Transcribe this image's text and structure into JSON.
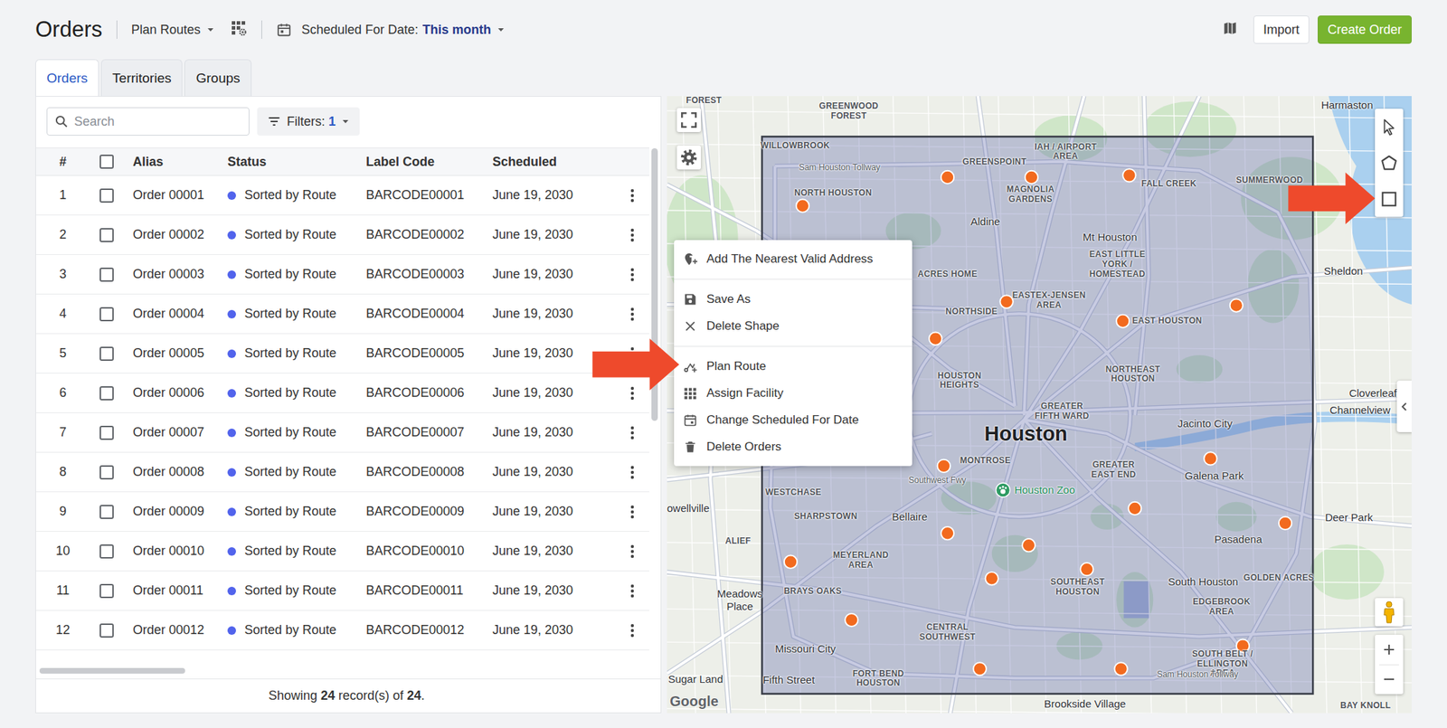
{
  "header": {
    "title": "Orders",
    "plan_routes": "Plan Routes",
    "date_label": "Scheduled For Date:",
    "date_value": "This month",
    "import": "Import",
    "create": "Create Order"
  },
  "tabs": [
    {
      "label": "Orders",
      "selected": true
    },
    {
      "label": "Territories",
      "selected": false
    },
    {
      "label": "Groups",
      "selected": false
    }
  ],
  "search": {
    "placeholder": "Search"
  },
  "filters": {
    "label": "Filters:",
    "count": "1"
  },
  "table": {
    "columns": [
      "#",
      "Alias",
      "Status",
      "Label Code",
      "Scheduled"
    ],
    "all_checked": false,
    "rows": [
      {
        "num": "1",
        "checked": false,
        "alias": "Order 00001",
        "status": "Sorted by Route",
        "label_code": "BARCODE00001",
        "scheduled": "June 19, 2030"
      },
      {
        "num": "2",
        "checked": false,
        "alias": "Order 00002",
        "status": "Sorted by Route",
        "label_code": "BARCODE00002",
        "scheduled": "June 19, 2030"
      },
      {
        "num": "3",
        "checked": false,
        "alias": "Order 00003",
        "status": "Sorted by Route",
        "label_code": "BARCODE00003",
        "scheduled": "June 19, 2030"
      },
      {
        "num": "4",
        "checked": false,
        "alias": "Order 00004",
        "status": "Sorted by Route",
        "label_code": "BARCODE00004",
        "scheduled": "June 19, 2030"
      },
      {
        "num": "5",
        "checked": false,
        "alias": "Order 00005",
        "status": "Sorted by Route",
        "label_code": "BARCODE00005",
        "scheduled": "June 19, 2030"
      },
      {
        "num": "6",
        "checked": false,
        "alias": "Order 00006",
        "status": "Sorted by Route",
        "label_code": "BARCODE00006",
        "scheduled": "June 19, 2030"
      },
      {
        "num": "7",
        "checked": false,
        "alias": "Order 00007",
        "status": "Sorted by Route",
        "label_code": "BARCODE00007",
        "scheduled": "June 19, 2030"
      },
      {
        "num": "8",
        "checked": false,
        "alias": "Order 00008",
        "status": "Sorted by Route",
        "label_code": "BARCODE00008",
        "scheduled": "June 19, 2030"
      },
      {
        "num": "9",
        "checked": false,
        "alias": "Order 00009",
        "status": "Sorted by Route",
        "label_code": "BARCODE00009",
        "scheduled": "June 19, 2030"
      },
      {
        "num": "10",
        "checked": false,
        "alias": "Order 00010",
        "status": "Sorted by Route",
        "label_code": "BARCODE00010",
        "scheduled": "June 19, 2030"
      },
      {
        "num": "11",
        "checked": false,
        "alias": "Order 00011",
        "status": "Sorted by Route",
        "label_code": "BARCODE00011",
        "scheduled": "June 19, 2030"
      },
      {
        "num": "12",
        "checked": false,
        "alias": "Order 00012",
        "status": "Sorted by Route",
        "label_code": "BARCODE00012",
        "scheduled": "June 19, 2030"
      }
    ]
  },
  "footer": {
    "showing": "Showing",
    "shown": "24",
    "records_of": "record(s) of",
    "total": "24",
    "end": "."
  },
  "map": {
    "attribution": "Google",
    "labels": [
      {
        "text": "FOREST",
        "kind": "district"
      },
      {
        "text": "GREENWOOD\nFOREST",
        "kind": "district"
      },
      {
        "text": "WILLOWBROOK",
        "kind": "district"
      },
      {
        "text": "GREENSPOINT",
        "kind": "district"
      },
      {
        "text": "IAH / AIRPORT\nAREA",
        "kind": "district"
      },
      {
        "text": "FALL CREEK",
        "kind": "district"
      },
      {
        "text": "SUMMERWOOD",
        "kind": "district"
      },
      {
        "text": "NORTH HOUSTON",
        "kind": "district"
      },
      {
        "text": "MAGNOLIA\nGARDENS",
        "kind": "district"
      },
      {
        "text": "EAST LITTLE\nYORK /\nHOMESTEAD",
        "kind": "district"
      },
      {
        "text": "ACRES HOME",
        "kind": "district"
      },
      {
        "text": "EASTEX-JENSEN\nAREA",
        "kind": "district"
      },
      {
        "text": "NORTHSIDE",
        "kind": "district"
      },
      {
        "text": "EAST HOUSTON",
        "kind": "district"
      },
      {
        "text": "HOUSTON\nHEIGHTS",
        "kind": "district"
      },
      {
        "text": "NORTHEAST\nHOUSTON",
        "kind": "district"
      },
      {
        "text": "GREATER\nFIFTH WARD",
        "kind": "district"
      },
      {
        "text": "MONTROSE",
        "kind": "district"
      },
      {
        "text": "GREATER\nEAST END",
        "kind": "district"
      },
      {
        "text": "WESTCHASE",
        "kind": "district"
      },
      {
        "text": "SHARPSTOWN",
        "kind": "district"
      },
      {
        "text": "ALIEF",
        "kind": "district"
      },
      {
        "text": "MEYERLAND\nAREA",
        "kind": "district"
      },
      {
        "text": "BRAYS OAKS",
        "kind": "district"
      },
      {
        "text": "SOUTHEAST\nHOUSTON",
        "kind": "district"
      },
      {
        "text": "GOLDEN ACRES",
        "kind": "district"
      },
      {
        "text": "EDGEBROOK\nAREA",
        "kind": "district"
      },
      {
        "text": "CENTRAL\nSOUTHWEST",
        "kind": "district"
      },
      {
        "text": "FORT BEND\nHOUSTON",
        "kind": "district"
      },
      {
        "text": "SOUTH BELT /\nELLINGTON\nAREA",
        "kind": "district"
      },
      {
        "text": "BAY KNOLL",
        "kind": "district"
      },
      {
        "text": "Harmaston",
        "kind": "city"
      },
      {
        "text": "Aldine",
        "kind": "city"
      },
      {
        "text": "Mt Houston",
        "kind": "city"
      },
      {
        "text": "Sheldon",
        "kind": "city"
      },
      {
        "text": "Cloverleaf",
        "kind": "city"
      },
      {
        "text": "Channelview",
        "kind": "city"
      },
      {
        "text": "Jacinto City",
        "kind": "city"
      },
      {
        "text": "Galena Park",
        "kind": "city"
      },
      {
        "text": "owellville",
        "kind": "city"
      },
      {
        "text": "Bellaire",
        "kind": "city"
      },
      {
        "text": "Deer Park",
        "kind": "city"
      },
      {
        "text": "Pasadena",
        "kind": "city"
      },
      {
        "text": "South Houston",
        "kind": "city"
      },
      {
        "text": "Meadows\nPlace",
        "kind": "city"
      },
      {
        "text": "Missouri City",
        "kind": "city"
      },
      {
        "text": "Sugar Land",
        "kind": "city"
      },
      {
        "text": "Fifth Street",
        "kind": "city"
      },
      {
        "text": "Brookside Village",
        "kind": "city"
      },
      {
        "text": "Houston",
        "kind": "major"
      },
      {
        "text": "Sam Houston Tollway",
        "kind": "road"
      },
      {
        "text": "Southwest Fwy",
        "kind": "road"
      },
      {
        "text": "Sam Houston Tollway",
        "kind": "road"
      },
      {
        "text": "Houston Zoo",
        "kind": "poi"
      }
    ]
  },
  "context_menu": {
    "sections": [
      {
        "items": [
          "Add The Nearest Valid Address"
        ]
      },
      {
        "items": [
          "Save As",
          "Delete Shape"
        ]
      },
      {
        "items": [
          "Plan Route",
          "Assign Facility",
          "Change Scheduled For Date",
          "Delete Orders"
        ]
      }
    ]
  }
}
